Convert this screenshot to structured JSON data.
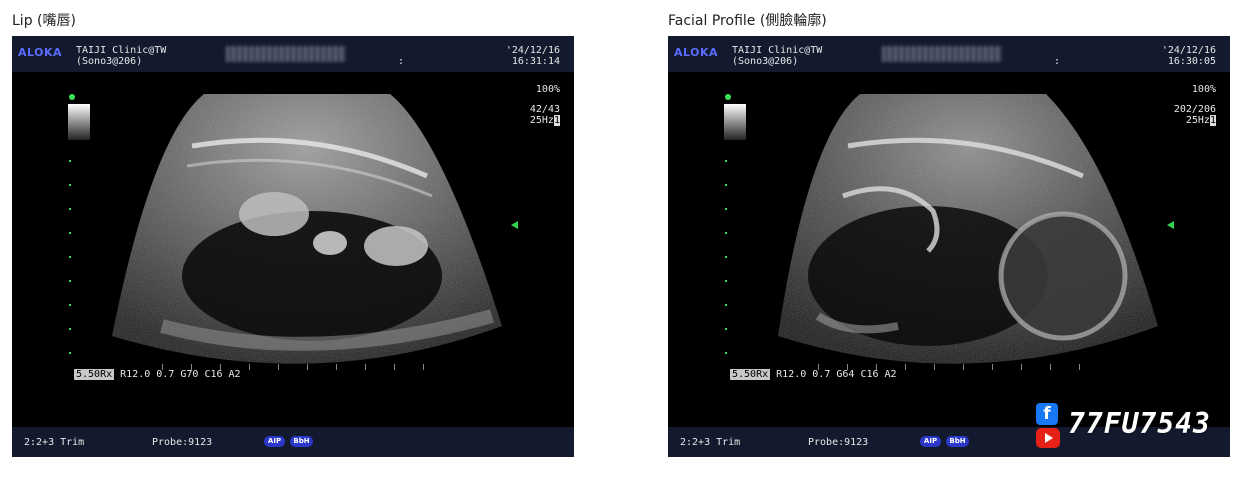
{
  "panels": [
    {
      "title": "Lip (嘴唇)",
      "brand": "ALOKA",
      "clinic_line1": "TAIJI Clinic@TW",
      "clinic_line2": "(Sono3@206)",
      "colon": ":",
      "date": "'24/12/16",
      "time": "16:31:14",
      "zoom": "100%",
      "frames": "42/43",
      "freq": "25Hz",
      "freq_flag": "1",
      "params_hl": "5.50Rx",
      "params": "R12.0 0.7 G70 C16 A2",
      "trim": "2:2+3 Trim",
      "probe": "Probe:9123",
      "badge1": "AIP",
      "badge2": "BbH"
    },
    {
      "title": "Facial Profile (側臉輪廓)",
      "brand": "ALOKA",
      "clinic_line1": "TAIJI Clinic@TW",
      "clinic_line2": "(Sono3@206)",
      "colon": ":",
      "date": "'24/12/16",
      "time": "16:30:05",
      "zoom": "100%",
      "frames": "202/206",
      "freq": "25Hz",
      "freq_flag": "1",
      "params_hl": "5.50Rx",
      "params": "R12.0 0.7 G64 C16 A2",
      "trim": "2:2+3 Trim",
      "probe": "Probe:9123",
      "badge1": "AIP",
      "badge2": "BbH"
    }
  ],
  "watermark": {
    "facebook_icon": "facebook-icon",
    "youtube_icon": "youtube-icon",
    "text": "77FU7543"
  },
  "colors": {
    "brand": "#5a6cff",
    "header_bg": "#141a2e",
    "scale_green": "#2fd44f",
    "badge_blue": "#2a39c9"
  }
}
